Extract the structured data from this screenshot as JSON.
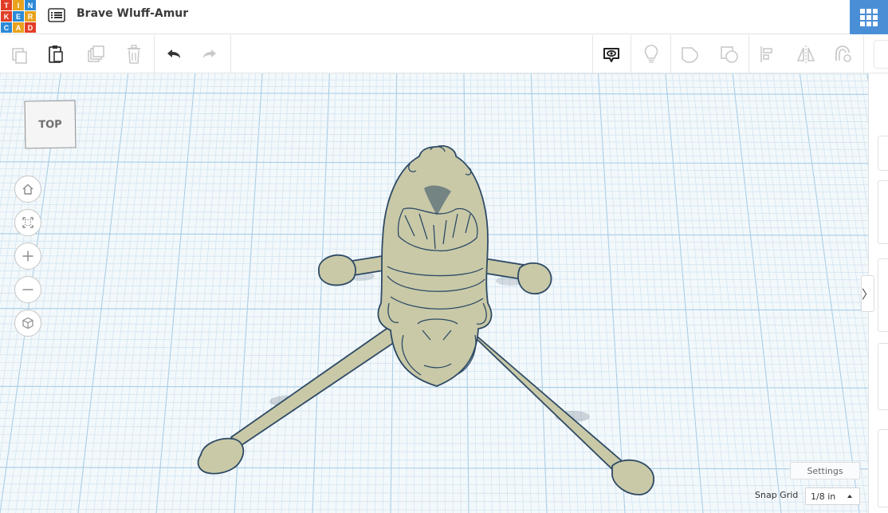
{
  "header": {
    "logo_letters": [
      "T",
      "I",
      "N",
      "K",
      "E",
      "R",
      "C",
      "A",
      "D"
    ],
    "logo_colors": [
      "#e23e27",
      "#e8a21d",
      "#2b8ad6",
      "#e23e27",
      "#2b8ad6",
      "#e8a21d",
      "#2b8ad6",
      "#e8a21d",
      "#e23e27"
    ],
    "design_title": "Brave Wluff-Amur",
    "apps_color": "#4a8fd6"
  },
  "toolbar": {
    "icons": [
      "copy-icon",
      "paste-icon",
      "duplicate-icon",
      "delete-icon",
      "undo-icon",
      "redo-icon",
      "notes-icon",
      "lightbulb-icon",
      "shape-icon",
      "hole-icon",
      "align-icon",
      "mirror-icon",
      "group-magnet-icon"
    ]
  },
  "viewcube": {
    "label": "TOP"
  },
  "view_controls": [
    "home-icon",
    "fit-view-icon",
    "zoom-in-icon",
    "zoom-out-icon",
    "perspective-cube-icon"
  ],
  "grid": {
    "minor_color": "#cfe3f0",
    "major_color": "#a9cde6",
    "background": "#f3f8fb"
  },
  "model": {
    "fill_color": "#c9c9a8",
    "edge_color": "#2e4a64"
  },
  "footer": {
    "settings_label": "Settings",
    "snap_grid_label": "Snap Grid",
    "snap_grid_value": "1/8 in"
  },
  "side_panel": {
    "toggle_glyph": "〉"
  }
}
